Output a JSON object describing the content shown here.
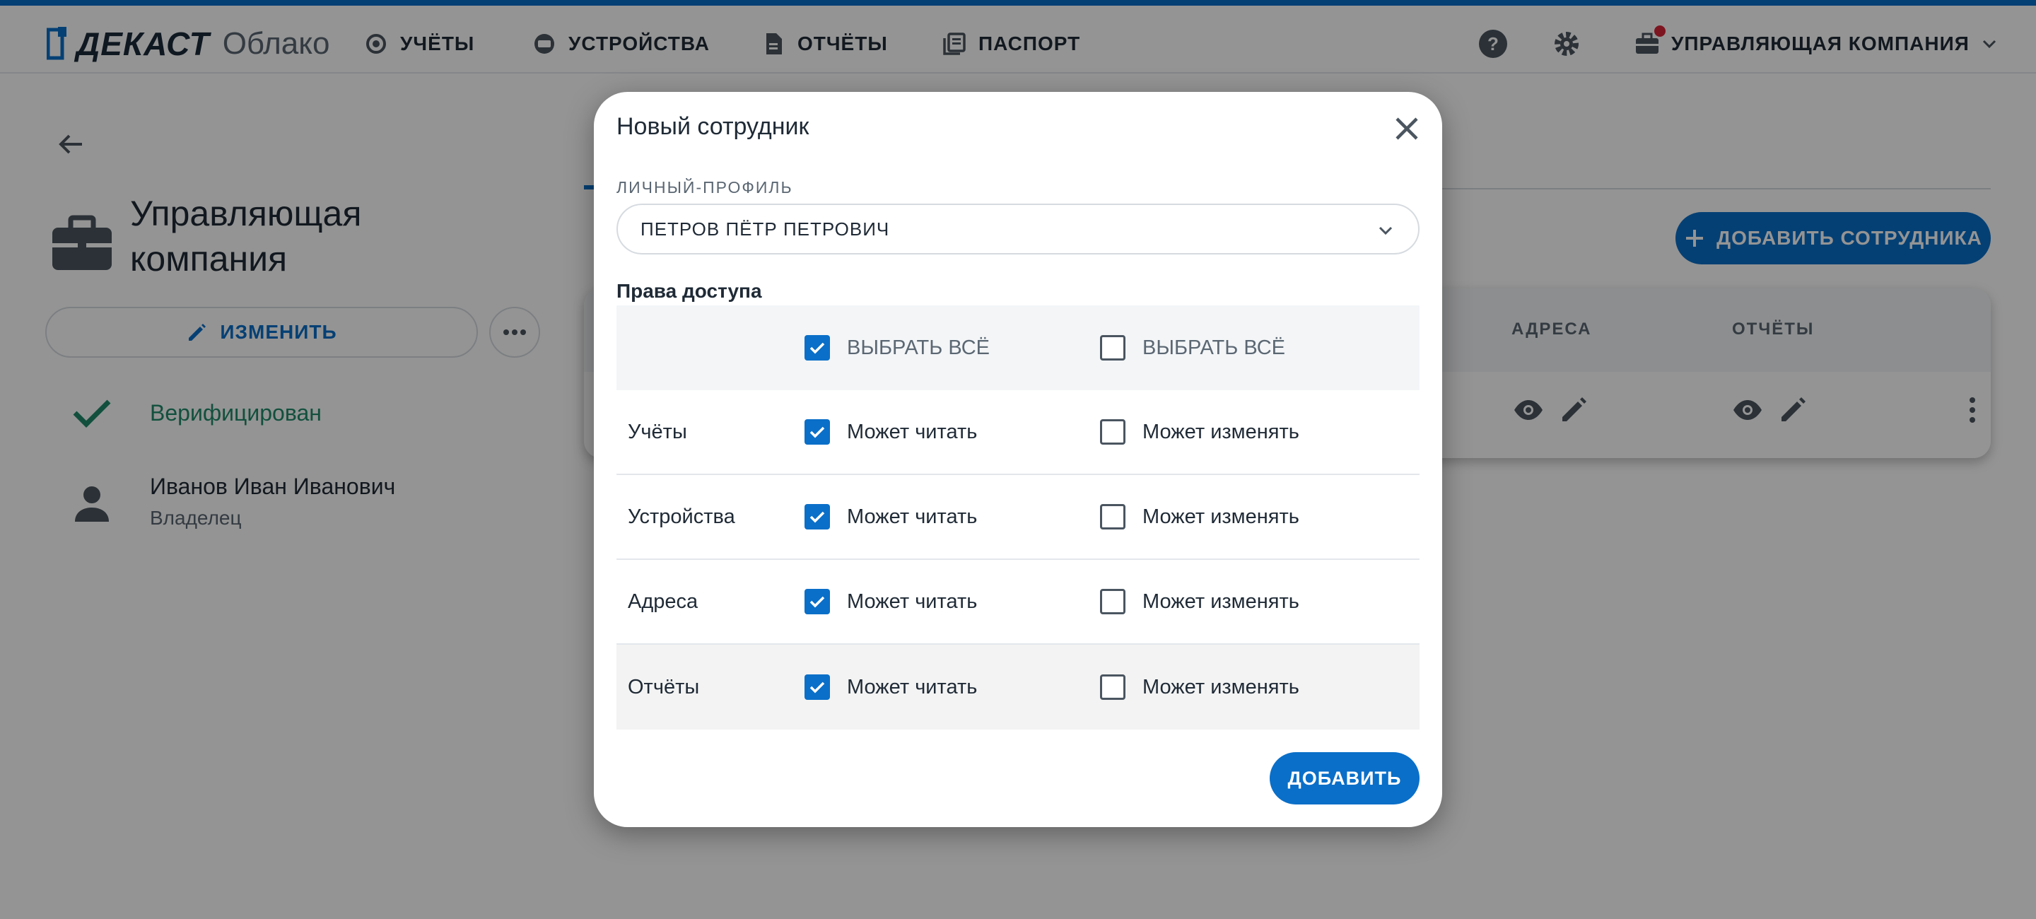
{
  "header": {
    "logo_brand": "ДЕКАСТ",
    "logo_sub": "Облако",
    "nav": [
      {
        "label": "УЧЁТЫ",
        "icon": "meter-icon"
      },
      {
        "label": "УСТРОЙСТВА",
        "icon": "device-icon"
      },
      {
        "label": "ОТЧЁТЫ",
        "icon": "document-icon"
      },
      {
        "label": "ПАСПОРТ",
        "icon": "passport-icon"
      }
    ],
    "company_label": "УПРАВЛЯЮЩАЯ КОМПАНИЯ"
  },
  "org": {
    "title": "Управляющая компания",
    "edit_label": "ИЗМЕНИТЬ",
    "status": "Верифицирован",
    "owner_name": "Иванов Иван Иванович",
    "owner_role": "Владелец"
  },
  "employees": {
    "add_label": "ДОБАВИТЬ СОТРУДНИКА",
    "columns": [
      "АДРЕСА",
      "ОТЧЁТЫ"
    ]
  },
  "dialog": {
    "title": "Новый сотрудник",
    "profile_label": "ЛИЧНЫЙ-ПРОФИЛЬ",
    "profile_value": "ПЕТРОВ ПЁТР ПЕТРОВИЧ",
    "rights_label": "Права доступа",
    "select_all_read": "ВЫБРАТЬ ВСЁ",
    "select_all_write": "ВЫБРАТЬ ВСЁ",
    "select_all_read_checked": true,
    "select_all_write_checked": false,
    "rows": [
      {
        "name": "Учёты",
        "read_label": "Может читать",
        "read": true,
        "write_label": "Может изменять",
        "write": false
      },
      {
        "name": "Устройства",
        "read_label": "Может читать",
        "read": true,
        "write_label": "Может изменять",
        "write": false
      },
      {
        "name": "Адреса",
        "read_label": "Может читать",
        "read": true,
        "write_label": "Может изменять",
        "write": false
      },
      {
        "name": "Отчёты",
        "read_label": "Может читать",
        "read": true,
        "write_label": "Может изменять",
        "write": false
      }
    ],
    "submit_label": "ДОБАВИТЬ"
  },
  "colors": {
    "accent": "#0a6fc8",
    "verified": "#1f8a6a",
    "notification": "#d62537"
  }
}
